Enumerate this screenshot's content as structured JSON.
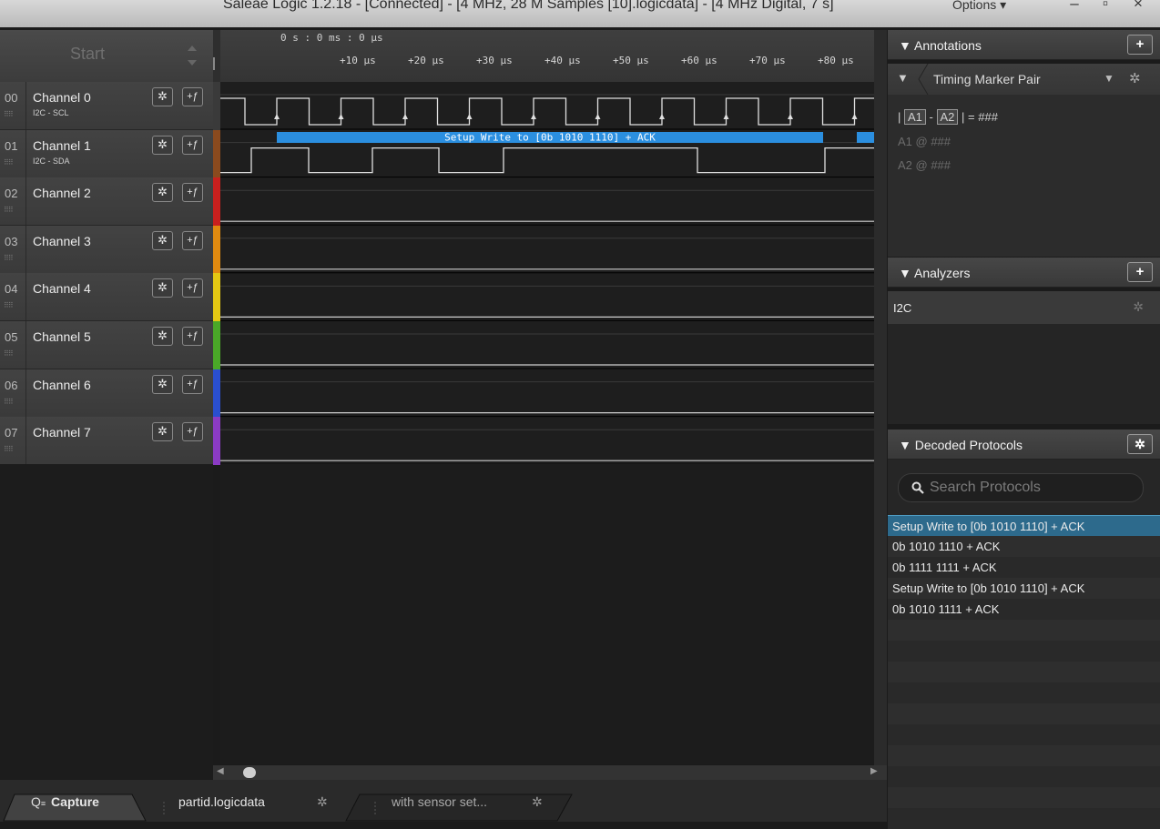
{
  "window": {
    "title": "Saleae Logic 1.2.18 - [Connected] - [4 MHz, 28 M Samples [10].logicdata] - [4 MHz Digital, 7 s]",
    "options_label": "Options ▾",
    "minimize": "–",
    "restore": "▫",
    "close": "×"
  },
  "toolbar": {
    "start_label": "Start"
  },
  "time_axis": {
    "origin": "0 s : 0 ms : 0 µs",
    "ticks": [
      "+10 µs",
      "+20 µs",
      "+30 µs",
      "+40 µs",
      "+50 µs",
      "+60 µs",
      "+70 µs",
      "+80 µs"
    ]
  },
  "channels": [
    {
      "num": "00",
      "name": "Channel 0",
      "sub": "I2C - SCL",
      "color": "#3a3a3a"
    },
    {
      "num": "01",
      "name": "Channel 1",
      "sub": "I2C - SDA",
      "color": "#8a4a1e"
    },
    {
      "num": "02",
      "name": "Channel 2",
      "sub": "",
      "color": "#c8201e"
    },
    {
      "num": "03",
      "name": "Channel 3",
      "sub": "",
      "color": "#e08a10"
    },
    {
      "num": "04",
      "name": "Channel 4",
      "sub": "",
      "color": "#e4c813"
    },
    {
      "num": "05",
      "name": "Channel 5",
      "sub": "",
      "color": "#4aa828"
    },
    {
      "num": "06",
      "name": "Channel 6",
      "sub": "",
      "color": "#2a4fcf"
    },
    {
      "num": "07",
      "name": "Channel 7",
      "sub": "",
      "color": "#8b3bc4"
    }
  ],
  "decoded_bubble": "Setup Write to [0b  1010  1110] + ACK",
  "tabs": {
    "capture": "Capture",
    "file1": "partid.logicdata",
    "file2": "with sensor set..."
  },
  "annotations": {
    "title": "Annotations",
    "add": "+",
    "item": "Timing Marker Pair",
    "formula_a1": "A1",
    "formula_a2": "A2",
    "formula_pre": "|",
    "formula_mid": "-",
    "formula_post": "| = ###",
    "a1_line": "A1  @  ###",
    "a2_line": "A2  @  ###"
  },
  "analyzers": {
    "title": "Analyzers",
    "add": "+",
    "items": [
      "I2C"
    ]
  },
  "decoded_protocols": {
    "title": "Decoded Protocols",
    "search_placeholder": "Search Protocols",
    "rows": [
      "Setup Write to [0b  1010  1110] + ACK",
      "0b  1010  1110 + ACK",
      "0b  1111  1111 + ACK",
      "Setup Write to [0b  1010  1110] + ACK",
      "0b  1010  1111 + ACK"
    ],
    "selected_index": 0
  },
  "colors": {
    "accent": "#2b8fe0",
    "selected_row": "#2d6a8c"
  },
  "icons": [
    "gear-icon",
    "trigger-icon",
    "search-icon",
    "pin-icon",
    "filter-icon",
    "triangle-down-icon"
  ]
}
